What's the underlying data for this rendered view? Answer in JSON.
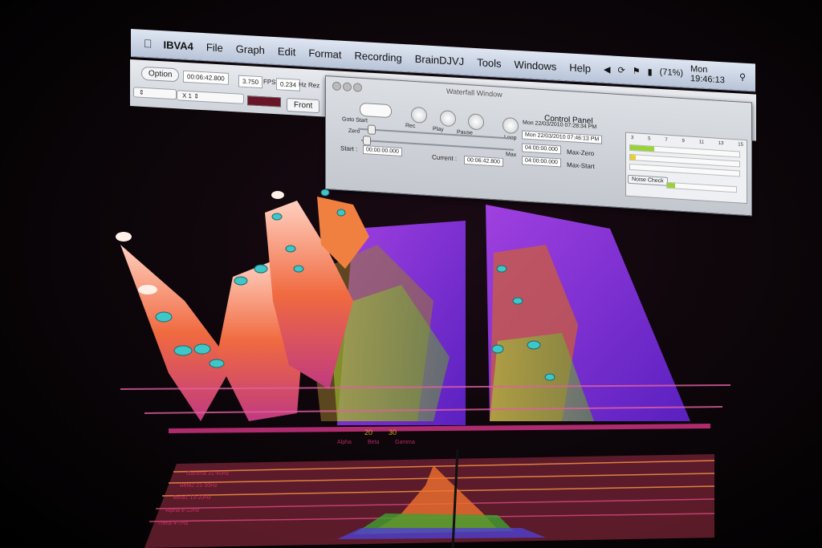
{
  "menubar": {
    "app_name": "IBVA4",
    "items": [
      "File",
      "Graph",
      "Edit",
      "Format",
      "Recording",
      "BrainDJVJ",
      "Tools",
      "Windows",
      "Help"
    ],
    "battery": "(71%)",
    "clock": "Mon 19:46:13"
  },
  "toolbar": {
    "option_label": "Option",
    "elapsed": "00:06:42.800",
    "fps_value": "3.750",
    "fps_label": "FPS",
    "hz_value": "0.234",
    "hz_label": "Hz Rez",
    "zoom_select": "X 1",
    "front_label": "Front"
  },
  "control_panel": {
    "window_title": "Waterfall Window",
    "title": "Control Panel",
    "goto_start_label": "Goto Start",
    "rec_label": "Rec",
    "play_label": "Play",
    "pause_label": "Pause",
    "loop_label": "Loop",
    "zero_label": "Zero",
    "max_label": "Max",
    "start_label": "Start :",
    "start_value": "00:00:00.000",
    "current_label": "Current :",
    "current_value": "00:06:42.800",
    "date_start": "Mon 22/03/2010 07:28:34 PM",
    "date_end": "Mon 22/03/2010 07:46:13 PM",
    "max_zero_value": "04:00:00.000",
    "max_zero_label": "Max-Zero",
    "max_start_value": "04:00:00.000",
    "max_start_label": "Max-Start",
    "noise_check_label": "Noise Check",
    "meter_scale": [
      "3",
      "5",
      "7",
      "9",
      "11",
      "13",
      "15"
    ]
  },
  "graph": {
    "x_labels_left": [
      "20",
      "30"
    ],
    "band_names": [
      "Alpha",
      "Beta",
      "Gamma"
    ]
  },
  "bands": {
    "labels_left": [
      "Gamma 31-40Hz",
      "Beta2 21-30Hz",
      "Beta1 13-20Hz",
      "Alpha 8-12Hz",
      "Theta 4-7Hz"
    ]
  },
  "colors": {
    "accent_magenta": "#c0307a",
    "peak_orange": "#f06a30",
    "surface_purple": "#7a2ad0",
    "marker_cyan": "#3fc6c8"
  }
}
